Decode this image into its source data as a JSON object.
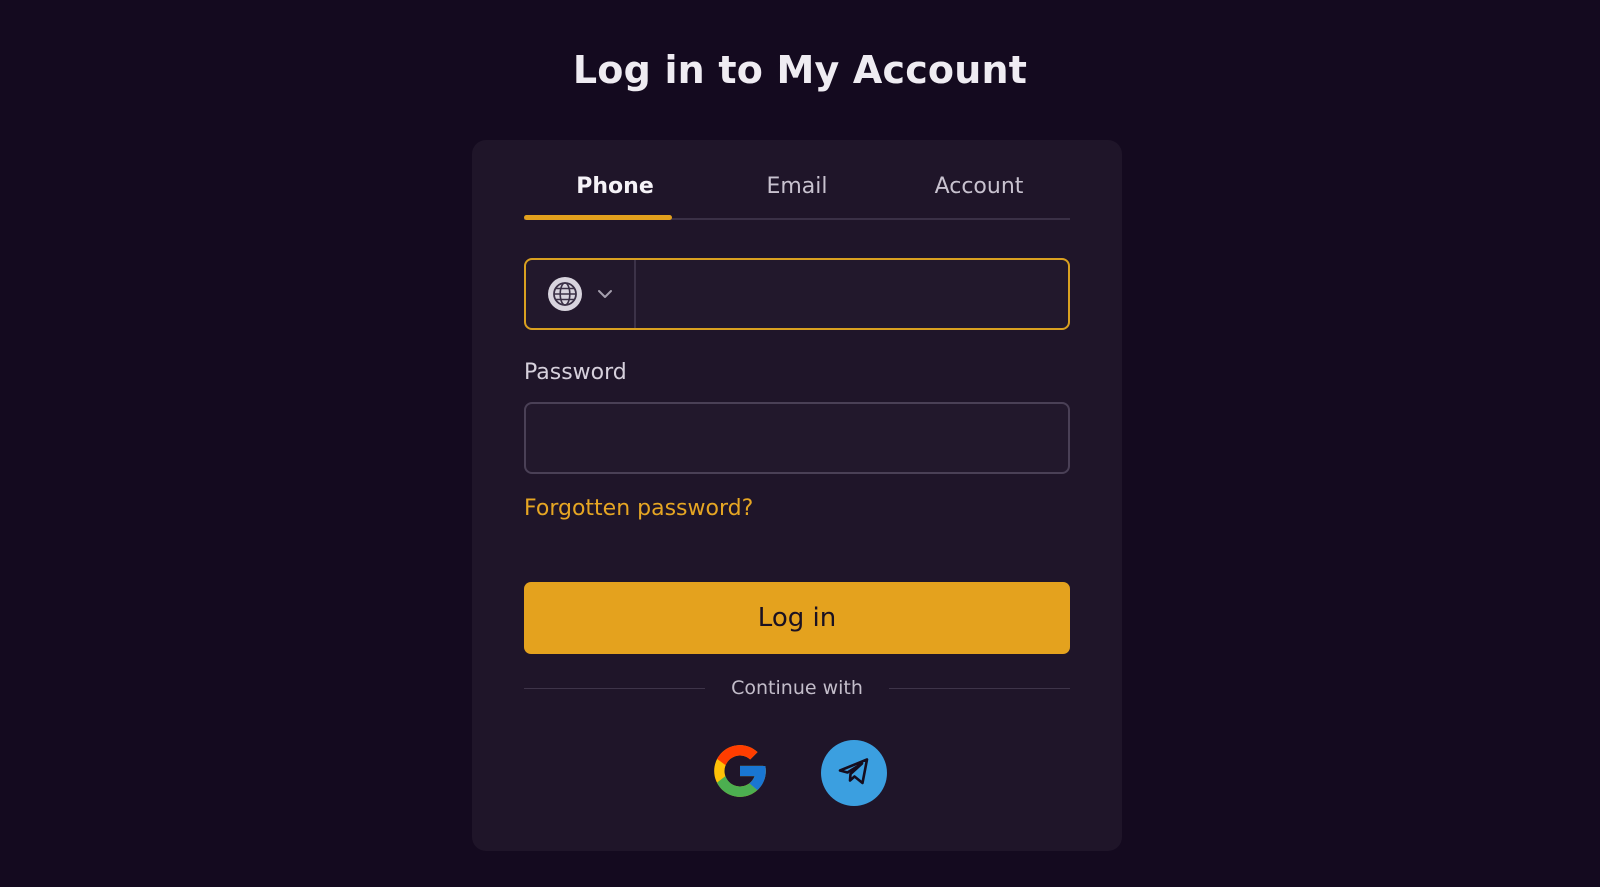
{
  "page": {
    "title": "Log in to My Account"
  },
  "tabs": [
    {
      "label": "Phone",
      "active": true
    },
    {
      "label": "Email",
      "active": false
    },
    {
      "label": "Account",
      "active": false
    }
  ],
  "phone": {
    "country_icon": "globe-icon",
    "dropdown_icon": "chevron-down-icon",
    "value": "",
    "placeholder": ""
  },
  "password": {
    "label": "Password",
    "value": "",
    "placeholder": ""
  },
  "links": {
    "forgot": "Forgotten password?"
  },
  "actions": {
    "login_label": "Log in"
  },
  "social": {
    "divider_text": "Continue with",
    "providers": [
      {
        "name": "google",
        "icon": "google-icon"
      },
      {
        "name": "telegram",
        "icon": "telegram-icon"
      }
    ]
  },
  "colors": {
    "background": "#140a1f",
    "card": "#1f1529",
    "accent": "#e4a21e",
    "telegram": "#3b9fe0"
  }
}
